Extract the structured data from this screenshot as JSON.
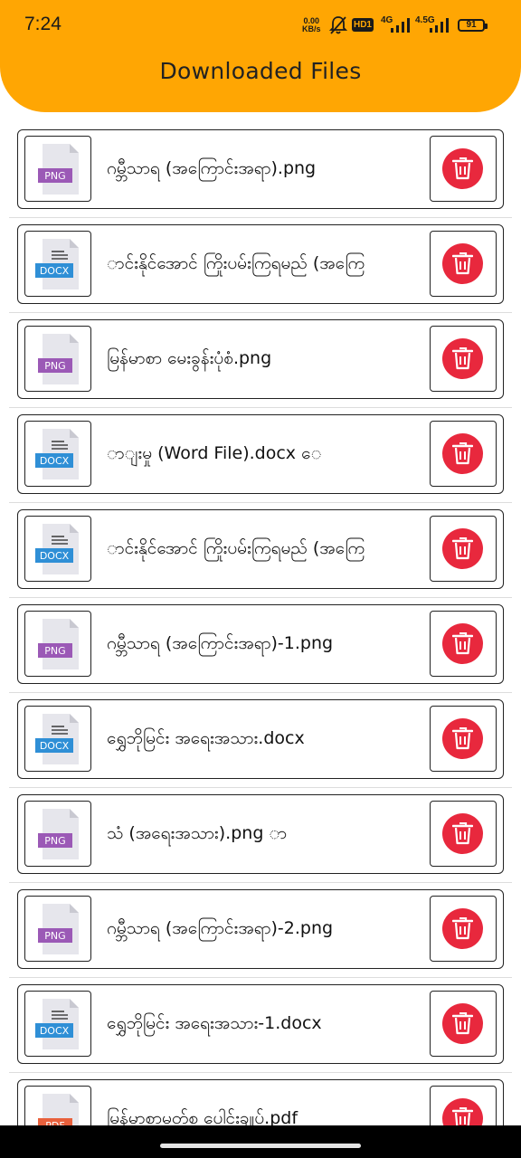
{
  "status_bar": {
    "time": "7:24",
    "net_speed_value": "0.00",
    "net_speed_unit": "KB/s",
    "hd_label": "HD1",
    "network_1": "4G",
    "network_2": "4.5G",
    "battery": "91",
    "icons": [
      "mute-bell-icon",
      "signal-icon",
      "signal-icon"
    ]
  },
  "header": {
    "title": "Downloaded Files",
    "color": "#ffa603"
  },
  "files": [
    {
      "name": "ဂမ္ဘီသာရ (အကြောင်းအရာ).png",
      "type": "PNG"
    },
    {
      "name": "ာင်းနိုင်အောင် ကြိုးပမ်းကြရမည် (အကြေ",
      "type": "DOCX"
    },
    {
      "name": "မြန်မာစာ မေးခွန်းပုံစံ.png",
      "type": "PNG"
    },
    {
      "name": "ာျးမှု (Word File).docx                  ေ",
      "type": "DOCX"
    },
    {
      "name": "ာင်းနိုင်အောင် ကြိုးပမ်းကြရမည် (အကြေ",
      "type": "DOCX"
    },
    {
      "name": "ဂမ္ဘီသာရ (အကြောင်းအရာ)-1.png",
      "type": "PNG"
    },
    {
      "name": "ရွှေဘိုမြင်း အရေးအသား.docx",
      "type": "DOCX"
    },
    {
      "name": "သံ (အရေးအသား).png                      ာ",
      "type": "PNG"
    },
    {
      "name": "ဂမ္ဘီသာရ (အကြောင်းအရာ)-2.png",
      "type": "PNG"
    },
    {
      "name": "ရွှေဘိုမြင်း အရေးအသား-1.docx",
      "type": "DOCX"
    },
    {
      "name": "မြန်မာစာမတ်စ ပေါင်းချုပ်.pdf",
      "type": "PDF"
    }
  ],
  "icons": {
    "delete": "trash-icon",
    "png": "png-file-icon",
    "docx": "docx-file-icon",
    "pdf": "pdf-file-icon"
  },
  "colors": {
    "delete_button": "#e8283d",
    "png_label": "#9b59b6",
    "docx_label": "#2f8fd6",
    "pdf_label": "#e8603c"
  }
}
